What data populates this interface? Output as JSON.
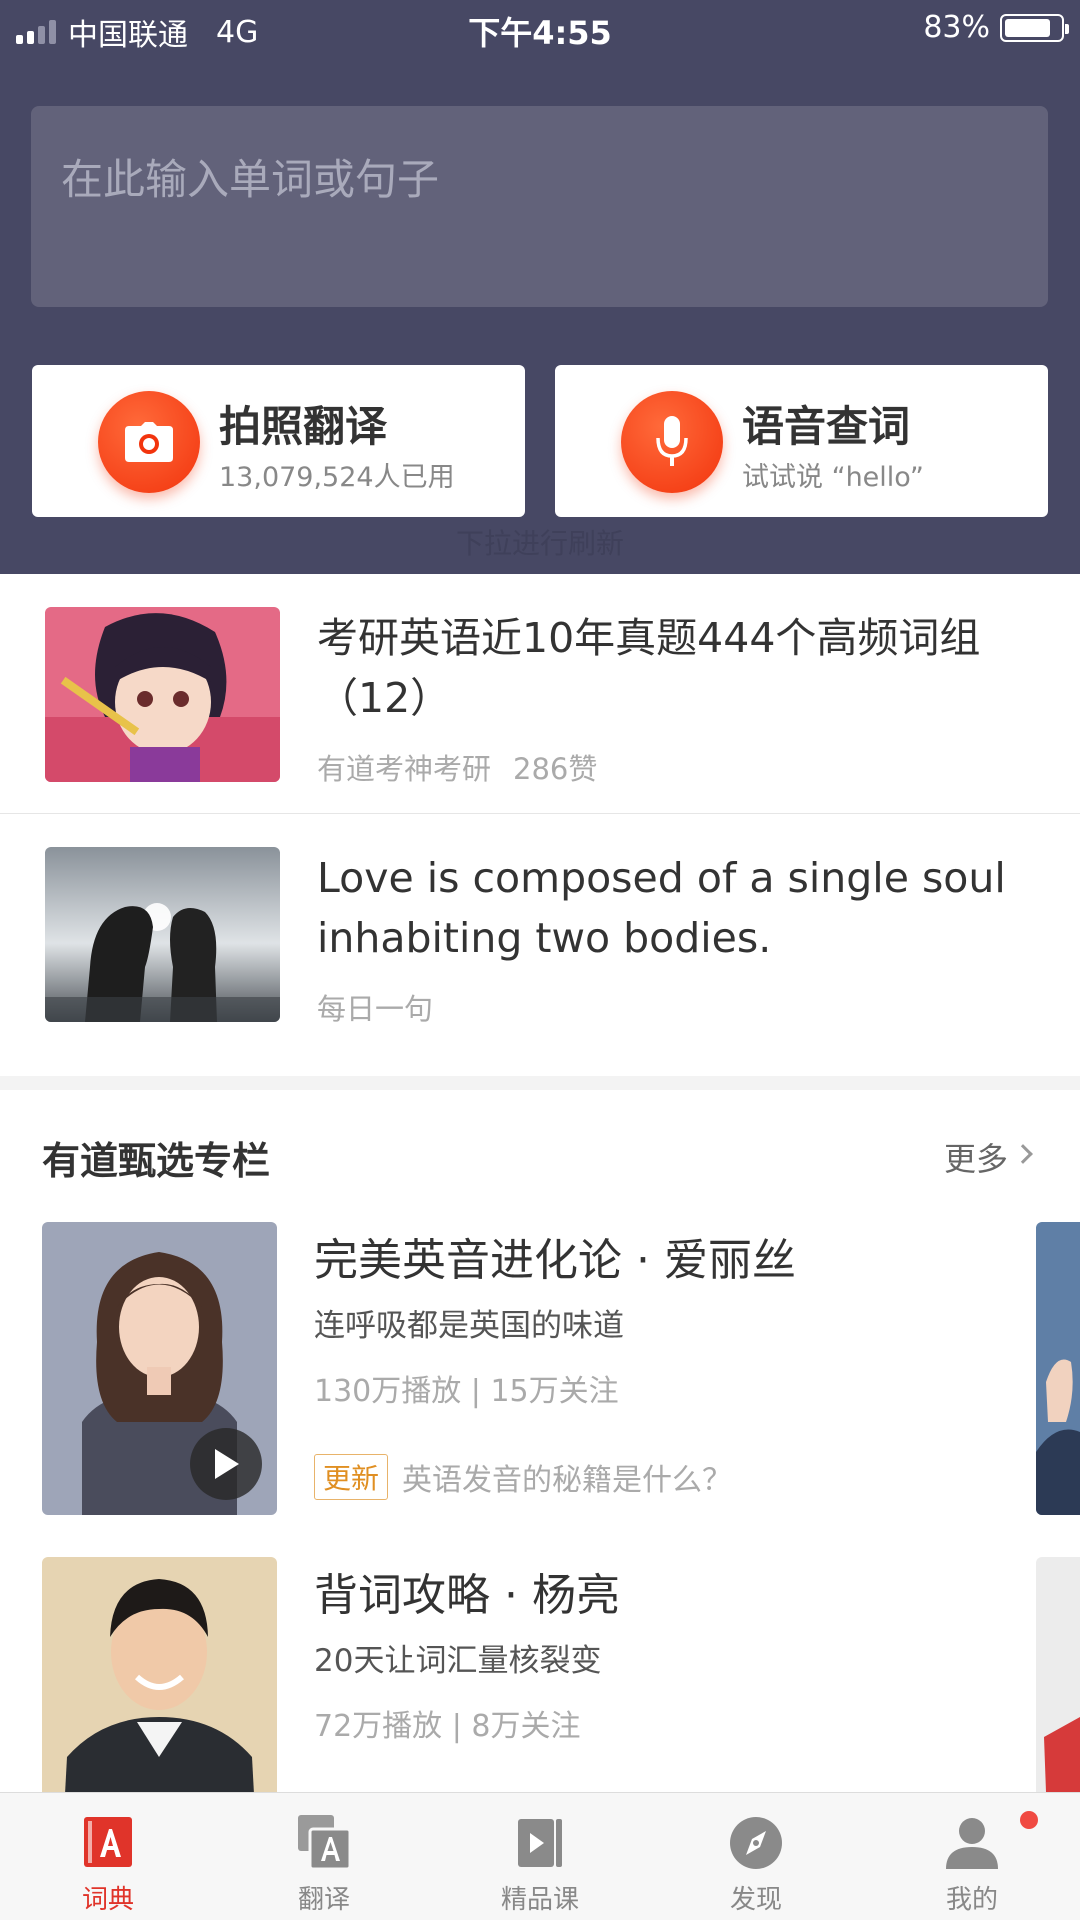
{
  "status_bar": {
    "carrier": "中国联通",
    "network": "4G",
    "time": "下午4:55",
    "battery": "83%"
  },
  "search": {
    "placeholder": "在此输入单词或句子"
  },
  "quick_actions": [
    {
      "title": "拍照翻译",
      "subtitle": "13,079,524人已用",
      "icon": "camera-icon"
    },
    {
      "title": "语音查词",
      "subtitle": "试试说 “hello”",
      "icon": "microphone-icon"
    }
  ],
  "pull_hint": "下拉进行刷新",
  "articles": [
    {
      "title": "考研英语近10年真题444个高频词组（12）",
      "source": "有道考神考研",
      "likes": "286赞"
    },
    {
      "title": "Love is composed of a single soul inhabiting two bodies.",
      "source": "每日一句"
    }
  ],
  "section": {
    "title": "有道甄选专栏",
    "more": "更多"
  },
  "courses": [
    {
      "title": "完美英音进化论 · 爱丽丝",
      "desc": "连呼吸都是英国的味道",
      "stats": "130万播放 | 15万关注",
      "tag": "更新",
      "update": "英语发音的秘籍是什么？"
    },
    {
      "title": "背词攻略 · 杨亮",
      "desc": "20天让词汇量核裂变",
      "stats": "72万播放 | 8万关注"
    }
  ],
  "tabs": [
    {
      "label": "词典",
      "icon": "dictionary-icon",
      "active": true
    },
    {
      "label": "翻译",
      "icon": "translate-icon"
    },
    {
      "label": "精品课",
      "icon": "course-icon"
    },
    {
      "label": "发现",
      "icon": "compass-icon"
    },
    {
      "label": "我的",
      "icon": "profile-icon",
      "badge": true
    }
  ],
  "colors": {
    "header_bg": "#474864",
    "accent": "#e0342a",
    "icon_red": "#f2340d"
  }
}
